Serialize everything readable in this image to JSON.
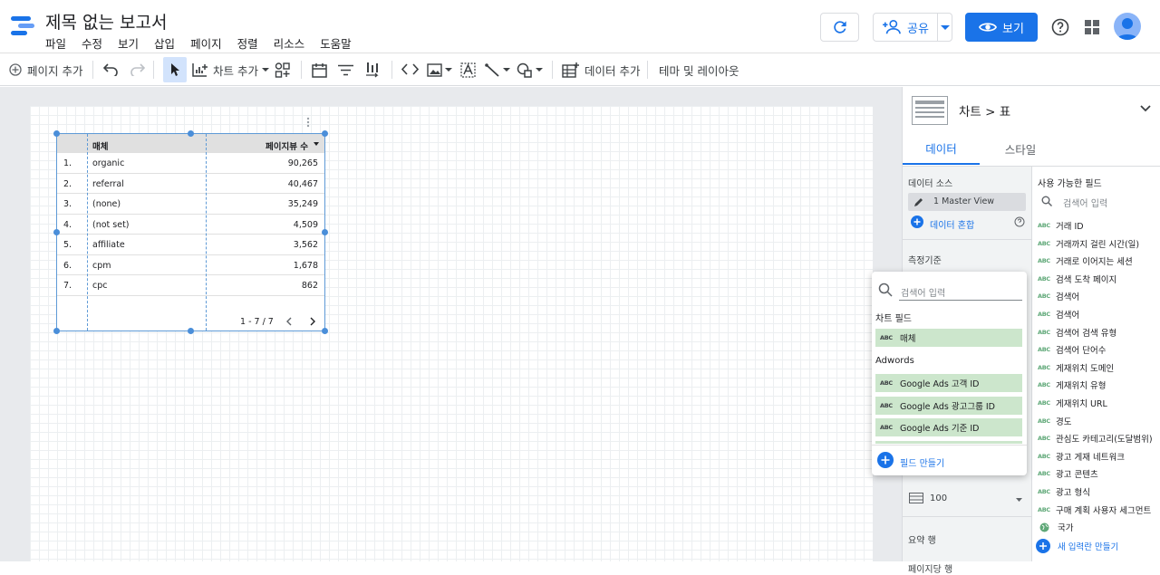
{
  "header": {
    "title": "제목 없는 보고서",
    "menu": [
      "파일",
      "수정",
      "보기",
      "삽입",
      "페이지",
      "정렬",
      "리소스",
      "도움말"
    ],
    "share_label": "공유",
    "view_label": "보기"
  },
  "toolbar": {
    "add_page": "페이지 추가",
    "add_chart": "차트 추가",
    "add_data": "데이터 추가",
    "theme_layout": "테마 및 레이아웃"
  },
  "table": {
    "columns": [
      "매체",
      "페이지뷰 수"
    ],
    "rows": [
      {
        "idx": "1.",
        "medium": "organic",
        "views": "90,265"
      },
      {
        "idx": "2.",
        "medium": "referral",
        "views": "40,467"
      },
      {
        "idx": "3.",
        "medium": "(none)",
        "views": "35,249"
      },
      {
        "idx": "4.",
        "medium": "(not set)",
        "views": "4,509"
      },
      {
        "idx": "5.",
        "medium": "affiliate",
        "views": "3,562"
      },
      {
        "idx": "6.",
        "medium": "cpm",
        "views": "1,678"
      },
      {
        "idx": "7.",
        "medium": "cpc",
        "views": "862"
      }
    ],
    "pagination": "1 - 7 / 7"
  },
  "panel": {
    "chart_type": "차트 > 표",
    "tab_data": "데이터",
    "tab_style": "스타일",
    "data_source_label": "데이터 소스",
    "data_source": "1 Master View",
    "blend_data": "데이터 혼합",
    "dimension_label": "측정기준",
    "rows_per_page_label": "페이지당 행",
    "rows_per_page": "100",
    "summary_row_label": "요약 행",
    "available_fields_label": "사용 가능한 필드",
    "search_placeholder": "검색어 입력",
    "fields": [
      "거래 ID",
      "거래까지 걸린 시간(일)",
      "거래로 이어지는 세션",
      "검색 도착 페이지",
      "검색어",
      "검색어",
      "검색어 검색 유형",
      "검색어 단어수",
      "게재위치 도메인",
      "게재위치 유형",
      "게재위치 URL",
      "경도",
      "관심도 카테고리(도달범위)",
      "광고 게재 네트워크",
      "광고 콘텐츠",
      "광고 형식",
      "구매 계획 사용자 세그먼트",
      "국가"
    ],
    "new_field": "새 입력란 만들기",
    "abc_tag": "ABC"
  },
  "popup": {
    "search_placeholder": "검색어 입력",
    "chart_fields_label": "차트 필드",
    "chart_field": "매체",
    "adwords_label": "Adwords",
    "adwords_fields": [
      "Google Ads 고객 ID",
      "Google Ads 광고그룹 ID",
      "Google Ads 기준 ID"
    ],
    "create_field": "필드 만들기"
  },
  "colors": {
    "accent": "#1a73e8",
    "field_green": "#cce6cc",
    "selection": "#4a8ed9"
  }
}
